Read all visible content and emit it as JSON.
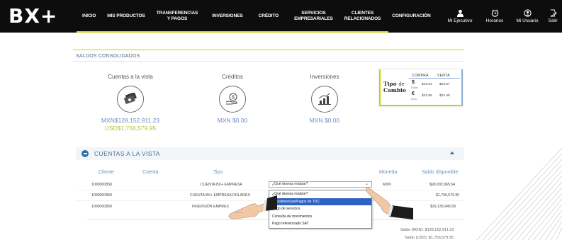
{
  "brand": {
    "logo": "BX+"
  },
  "nav": {
    "items": [
      {
        "label": "INICIO"
      },
      {
        "label": "MIS PRODUCTOS"
      },
      {
        "label": "TRANSFERENCIAS\nY PAGOS"
      },
      {
        "label": "INVERSIONES"
      },
      {
        "label": "CRÉDITO"
      },
      {
        "label": "SERVICIOS\nEMPRESARIALES"
      },
      {
        "label": "CLIENTES\nRELACIONADOS"
      },
      {
        "label": "CONFIGURACIÓN"
      }
    ],
    "right": [
      {
        "label": "Mi Ejecutivo",
        "icon": "user-icon"
      },
      {
        "label": "Horarios",
        "icon": "clock-icon"
      },
      {
        "label": "Mi Usuario",
        "icon": "user-circle-icon"
      },
      {
        "label": "Salir",
        "icon": "logout-icon"
      }
    ]
  },
  "saldos": {
    "title": "SALDOS CONSOLIDADOS",
    "cuentas": {
      "label": "Cuentas a la vista",
      "amount_mxn": "MXN$128,152,911.23",
      "amount_usd": "USD$1,756,579.95",
      "icon": "cash-icon"
    },
    "creditos": {
      "label": "Créditos",
      "amount": "MXN $0.00",
      "icon": "money-hand-icon"
    },
    "inversiones": {
      "label": "Inversiones",
      "amount": "MXN $0.00",
      "icon": "investment-chart-icon"
    }
  },
  "tipo_cambio": {
    "title_a": "Tipo",
    "title_b": "de",
    "title_c": "Cambio",
    "compra_label": "COMPRA",
    "venta_label": "VENTA",
    "rows": [
      {
        "symbol": "$",
        "name": "Dólar",
        "compra": "$19.04",
        "venta": "$20.57"
      },
      {
        "symbol": "€",
        "name": "Euro",
        "compra": "$22.85",
        "venta": "$24.48"
      }
    ]
  },
  "cuentas_vista": {
    "title": "CUENTAS A LA VISTA",
    "headers": {
      "cliente": "Cliente",
      "cuenta": "Cuenta",
      "tipo": "Tipo",
      "moneda": "Moneda",
      "saldo": "Saldo disponible"
    },
    "rows": [
      {
        "cliente": "1000000858",
        "tipo": "CUENTA BX+ EMPRESA",
        "moneda": "MXN",
        "saldo": "$99,002,965.54"
      },
      {
        "cliente": "1000000858",
        "tipo": "CUENTA BX+ EMPRESA DOLARES",
        "moneda": "",
        "saldo": "$1,756,579.95"
      },
      {
        "cliente": "1000000858",
        "tipo": "INVERSIÓN EMPRES",
        "moneda": "M",
        "saldo": "$29,139,945.69"
      }
    ],
    "select": {
      "value": "¿Qué deseas realizar?"
    },
    "dropdown": [
      {
        "label": "¿Qué deseas realizar?",
        "selected": false
      },
      {
        "label": "Transferencias/Pagos de TDC",
        "selected": true
      },
      {
        "label": "Pago de servicios",
        "selected": false
      },
      {
        "label": "Consulta de movimientos",
        "selected": false
      },
      {
        "label": "Pago referenciado SAT",
        "selected": false
      }
    ],
    "totals": {
      "mxn": "Saldo (MXN): $128,152,911.23",
      "usd": "Saldo (USD): $1,756,579.95"
    }
  },
  "colors": {
    "accent": "#c8d400",
    "blue": "#6a8fbf",
    "nav_bg": "#0d0d0d",
    "highlight": "#2e63c4"
  }
}
